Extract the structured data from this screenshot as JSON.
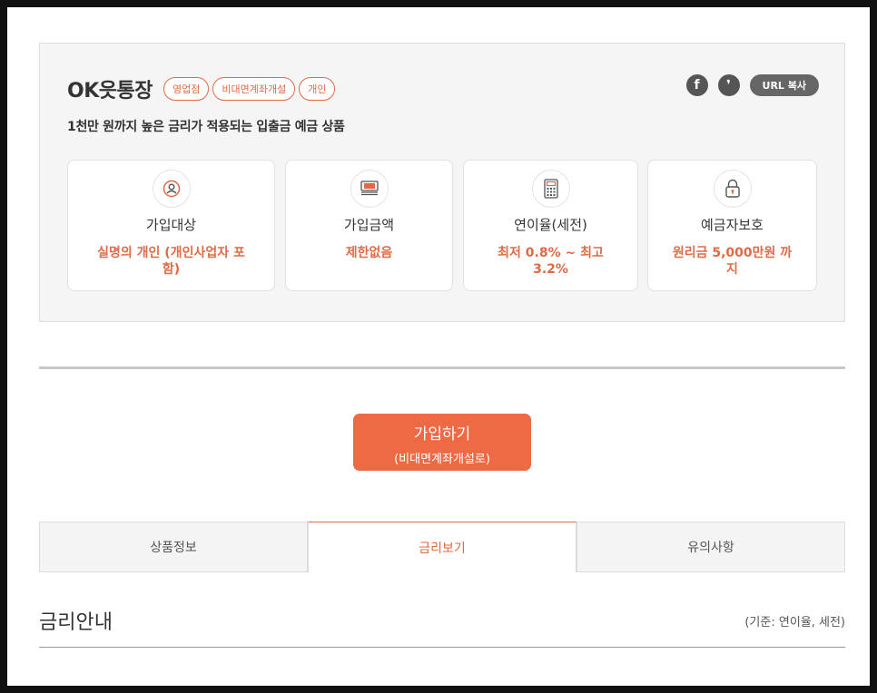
{
  "product": {
    "title": "OK읏통장",
    "tags": [
      "영업점",
      "비대면계좌개설",
      "개인"
    ],
    "subtitle": "1천만 원까지 높은 금리가 적용되는 입출금 예금 상품",
    "share": {
      "facebook_glyph": "f",
      "kakao_glyph": "❜",
      "url_copy_label": "URL 복사"
    },
    "info": [
      {
        "icon": "person-icon",
        "label": "가입대상",
        "value": "실명의 개인 (개인사업자 포함)"
      },
      {
        "icon": "money-icon",
        "label": "가입금액",
        "value": "제한없음"
      },
      {
        "icon": "calculator-icon",
        "label": "연이율(세전)",
        "value": "최저 0.8% ~ 최고 3.2%"
      },
      {
        "icon": "lock-icon",
        "label": "예금자보호",
        "value": "원리금 5,000만원 까지"
      }
    ]
  },
  "join": {
    "label": "가입하기",
    "sub_label": "(비대면계좌개설로)"
  },
  "tabs": [
    {
      "label": "상품정보",
      "active": false
    },
    {
      "label": "금리보기",
      "active": true
    },
    {
      "label": "유의사항",
      "active": false
    }
  ],
  "section": {
    "title": "금리안내",
    "note": "(기준: 연이율, 세전)"
  },
  "colors": {
    "accent": "#ee6a45",
    "accent_text": "#e06a45",
    "card_bg": "#f5f5f5"
  }
}
